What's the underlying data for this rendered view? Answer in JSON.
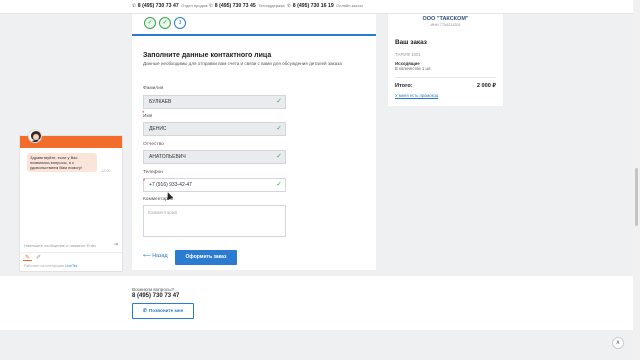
{
  "topbar": {
    "phones": [
      {
        "number": "8 (495) 730 73 47",
        "label": "Отдел продаж"
      },
      {
        "number": "8 (495) 730 73 45",
        "label": "Техподдержка"
      },
      {
        "number": "8 (495) 730 16 19",
        "label": "Онлайн-кассы"
      }
    ]
  },
  "steps": {
    "items": [
      {
        "mark": "✓"
      },
      {
        "mark": "✓"
      },
      {
        "mark": "3"
      }
    ]
  },
  "form": {
    "title": "Заполните данные контактного лица",
    "description": "Данные необходимы для отправки вам счета и связи с вами для обсуждения деталей заказа",
    "fields": {
      "last_name": {
        "label": "Фамилия",
        "value": "БУЛКАЕВ",
        "required": "*"
      },
      "first_name": {
        "label": "Имя",
        "value": "ДЕНИС",
        "required": "*"
      },
      "middle_name": {
        "label": "Отчество",
        "value": "АНАТОЛЬЕВИЧ"
      },
      "phone": {
        "label": "Телефон",
        "value": "+7 (916) 933-42-47",
        "required": "*"
      },
      "comment": {
        "label": "Комментарий",
        "placeholder": "Комментарий"
      }
    },
    "check": "✓",
    "back_label": "⟵ Назад",
    "submit_label": "Оформить заказ"
  },
  "order": {
    "org_name": "ООО \"ТАКСКОМ\"",
    "org_inn": "ИНН 7704211201",
    "title": "Ваш заказ",
    "tariff": "ТАРИФ 1001",
    "includes_label": "Исходящие",
    "includes_qty": "В количестве 1 шт.",
    "total_label": "Итого:",
    "total_value": "2 000 ₽",
    "promo_link": "У меня есть промокод"
  },
  "chat": {
    "greeting": "Здравствуйте, если у Вас появились вопросы, я с удовольствием Вам помогу!",
    "time": "12:00",
    "input_placeholder": "Напишите сообщение и нажмите Enter",
    "attach_icon": "⇥",
    "icon_a": "✎",
    "icon_b": "✐",
    "footer_text": "Работает на платформе",
    "footer_link": "LiveTex"
  },
  "footer": {
    "question": "Возникли вопросы?",
    "phone": "8 (495) 730 73 47",
    "callback_icon": "✆",
    "callback_label": "Позвоните мне"
  },
  "scroll_up_icon": "∧",
  "colors": {
    "accent": "#2b7bd0",
    "success": "#39a84b",
    "chat_brand": "#f26d2c"
  }
}
